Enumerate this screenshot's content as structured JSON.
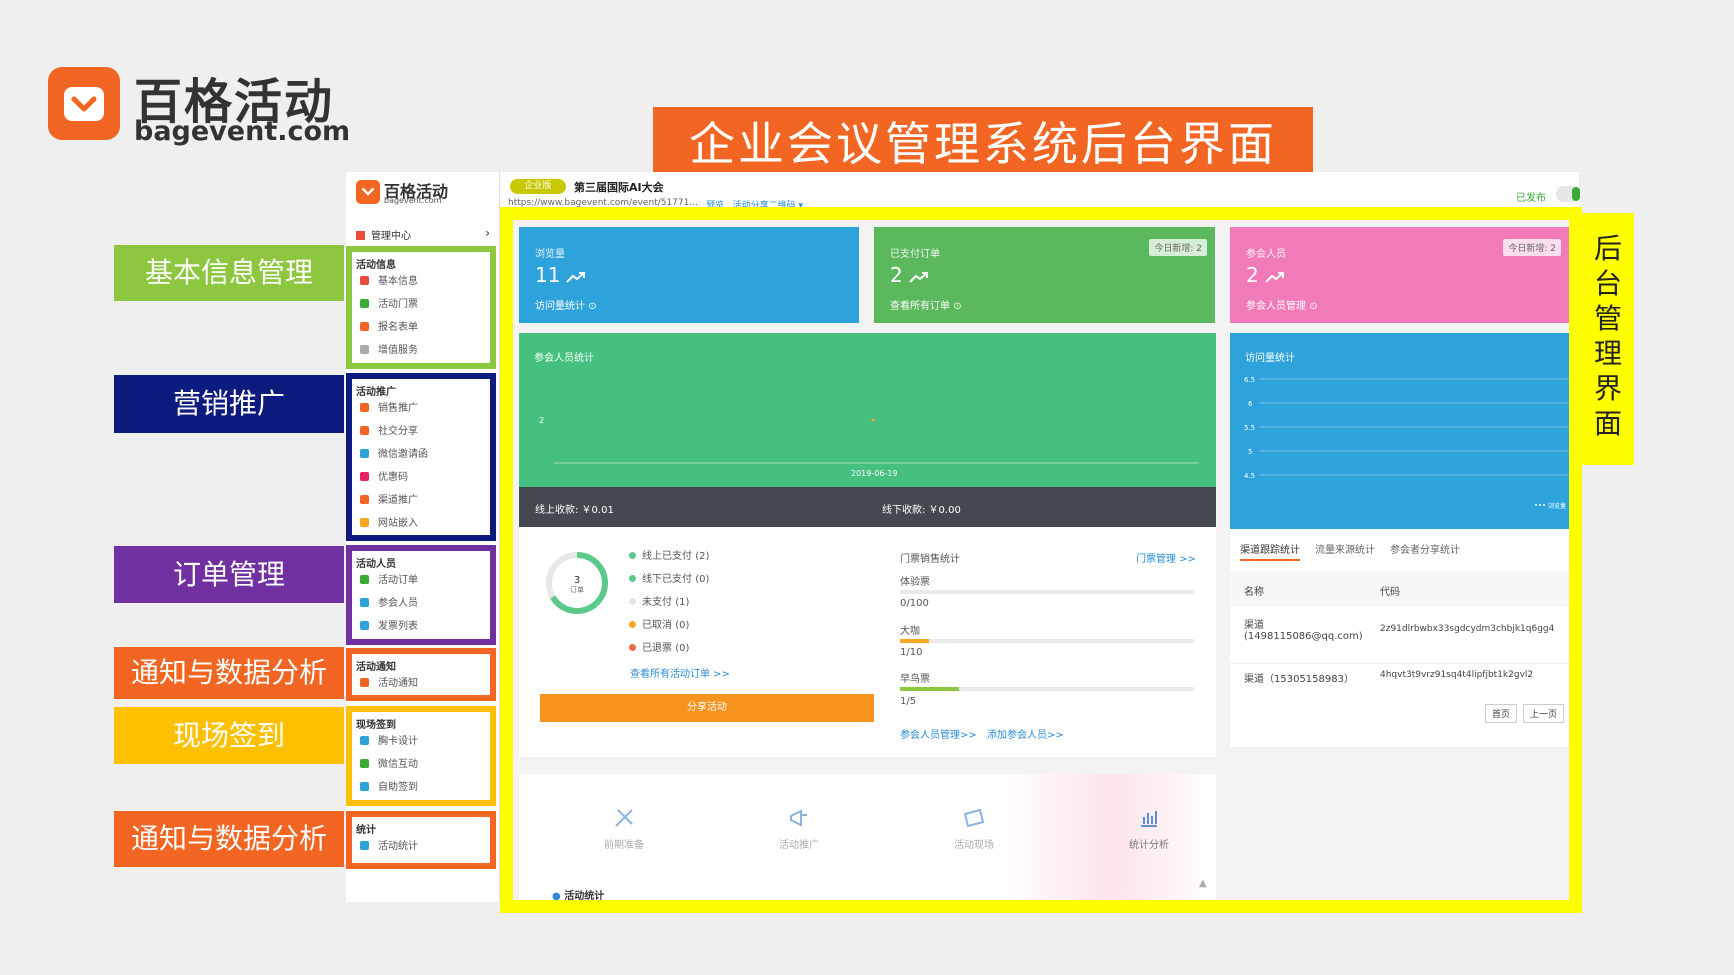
{
  "brand": {
    "name_cn": "百格活动",
    "domain": "bagevent.com"
  },
  "headline": "企业会议管理系统后台界面",
  "side_labels": [
    {
      "text": "基本信息管理",
      "color": "#8dc63f"
    },
    {
      "text": "营销推广",
      "color": "#0d1a7e"
    },
    {
      "text": "订单管理",
      "color": "#7030a0"
    },
    {
      "text": "通知与数据分析",
      "color": "#f26522"
    },
    {
      "text": "现场签到",
      "color": "#ffc000"
    },
    {
      "text": "通知与数据分析",
      "color": "#f26522"
    }
  ],
  "vertical_label": "后台管理界面",
  "app": {
    "logo_cn": "百格活动",
    "logo_en": "bagevent.com",
    "mgmt_center": "管理中心",
    "sections": [
      {
        "title": "活动信息",
        "items": [
          "基本信息",
          "活动门票",
          "报名表单",
          "增值服务"
        ]
      },
      {
        "title": "活动推广",
        "items": [
          "销售推广",
          "社交分享",
          "微信邀请函",
          "优惠码",
          "渠道推广",
          "网站嵌入"
        ]
      },
      {
        "title": "活动人员",
        "items": [
          "活动订单",
          "参会人员",
          "发票列表"
        ]
      },
      {
        "title": "活动通知",
        "items": [
          "活动通知"
        ]
      },
      {
        "title": "现场签到",
        "items": [
          "胸卡设计",
          "微信互动",
          "自助签到"
        ]
      },
      {
        "title": "统计",
        "items": [
          "活动统计"
        ]
      }
    ],
    "edition_badge": "企业版",
    "event_title": "第三届国际AI大会",
    "event_url": "https://www.bagevent.com/event/51771...",
    "preview_link": "预览",
    "share_qr_link": "活动分享二维码",
    "status": "已发布"
  },
  "stats": [
    {
      "label": "浏览量",
      "value": "11",
      "link": "访问量统计",
      "color": "#2ea3db",
      "badge": ""
    },
    {
      "label": "已支付订单",
      "value": "2",
      "link": "查看所有订单",
      "color": "#5cb85c",
      "badge": "今日新增: 2"
    },
    {
      "label": "参会人员",
      "value": "2",
      "link": "参会人员管理",
      "color": "#f07bb8",
      "badge": "今日新增: 2"
    }
  ],
  "attendee_chart": {
    "title": "参会人员统计",
    "y_tick": "2",
    "x_tick": "2019-06-19"
  },
  "revenue": {
    "online": "线上收款: ￥0.01",
    "offline": "线下收款: ￥0.00"
  },
  "visit_chart": {
    "title": "访问量统计",
    "y_ticks": [
      "6.5",
      "6",
      "5.5",
      "5",
      "4.5"
    ],
    "legend": "浏览量"
  },
  "orders": {
    "total": "3",
    "unit": "订单",
    "items": [
      {
        "label": "线上已支付",
        "count": "(2)",
        "color": "#5cc98a"
      },
      {
        "label": "线下已支付",
        "count": "(0)",
        "color": "#5cc98a"
      },
      {
        "label": "未支付",
        "count": "(1)",
        "color": "#e5e5e5"
      },
      {
        "label": "已取消",
        "count": "(0)",
        "color": "#f5a623"
      },
      {
        "label": "已退票",
        "count": "(0)",
        "color": "#ef6b4a"
      }
    ],
    "view_all": "查看所有活动订单 >>",
    "share_button": "分享活动"
  },
  "tickets": {
    "title": "门票销售统计",
    "manage_link": "门票管理 >>",
    "rows": [
      {
        "name": "体验票",
        "ratio": "0/100",
        "fill": 0.0,
        "color": "#f5a623"
      },
      {
        "name": "大咖",
        "ratio": "1/10",
        "fill": 0.1,
        "color": "#f5a623"
      },
      {
        "name": "早鸟票",
        "ratio": "1/5",
        "fill": 0.2,
        "color": "#8dc63f"
      }
    ],
    "attendee_link": "参会人员管理>>",
    "add_link": "添加参会人员>>"
  },
  "channel": {
    "tabs": [
      "渠道跟踪统计",
      "流量来源统计",
      "参会者分享统计"
    ],
    "headers": [
      "名称",
      "代码"
    ],
    "rows": [
      {
        "name1": "渠道",
        "name2": "(1498115086@qq.com)",
        "code": "2z91dlrbwbx33sgdcydm3chbjk1q6gg4"
      },
      {
        "name1": "渠道（15305158983）",
        "name2": "",
        "code": "4hqvt3t9vrz91sq4t4lipfjbt1k2gvl2"
      }
    ],
    "first_page": "首页",
    "prev_page": "上一页"
  },
  "steps": [
    "前期准备",
    "活动推广",
    "活动现场",
    "统计分析"
  ],
  "footer_title": "活动统计"
}
